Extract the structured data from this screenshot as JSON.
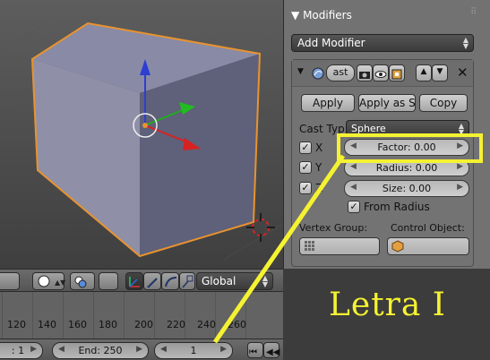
{
  "properties": {
    "title": "Modifiers",
    "add_modifier": "Add Modifier",
    "modifier_name": "ast",
    "apply": "Apply",
    "apply_as_shape": "Apply as Sh",
    "copy": "Copy",
    "cast_type_label": "Cast Typ",
    "cast_type_value": "Sphere",
    "axis_x": "X",
    "axis_y": "Y",
    "axis_z": "Z",
    "factor": "Factor: 0.00",
    "radius": "Radius: 0.00",
    "size": "Size: 0.00",
    "from_radius": "From Radius",
    "vertex_group": "Vertex Group:",
    "control_object": "Control Object:"
  },
  "header": {
    "orientation": "Global"
  },
  "timeline": {
    "ticks": [
      "120",
      "140",
      "160",
      "180",
      "200",
      "220",
      "240",
      "260"
    ]
  },
  "frame_bar": {
    "start": ": 1",
    "end": "End: 250",
    "current": "1"
  },
  "annotation": {
    "text": "Letra I",
    "color": "#f5f232"
  },
  "icons": [
    "wrench-icon",
    "camera-icon",
    "eye-icon",
    "render-icon",
    "arrow-up-icon",
    "arrow-down-icon",
    "close-icon",
    "cube-icon",
    "grid-icon",
    "cursor-icon"
  ]
}
